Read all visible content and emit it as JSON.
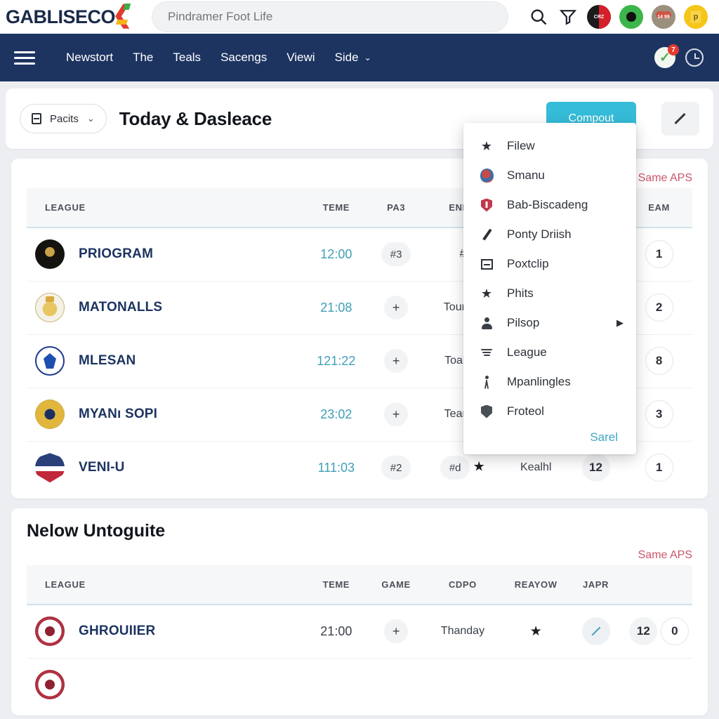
{
  "brand": {
    "name": "GABLISECO",
    "mark": "chevron-mark"
  },
  "search": {
    "placeholder": "Pindramer Foot Life",
    "value": ""
  },
  "top_icons": [
    {
      "name": "search-icon",
      "label": ""
    },
    {
      "name": "funnel-icon",
      "label": ""
    },
    {
      "name": "avatar-1",
      "label": "CRZ"
    },
    {
      "name": "avatar-2",
      "label": ""
    },
    {
      "name": "avatar-3",
      "label": "14 99"
    },
    {
      "name": "avatar-4",
      "label": "p"
    }
  ],
  "nav": {
    "menu_icon": "hamburger-icon",
    "items": [
      {
        "label": "Newstort",
        "caret": false
      },
      {
        "label": "The",
        "caret": false
      },
      {
        "label": "Teals",
        "caret": false
      },
      {
        "label": "Sacengs",
        "caret": false
      },
      {
        "label": "Viewi",
        "caret": false
      },
      {
        "label": "Side",
        "caret": true
      }
    ],
    "caret_glyph": "⌄",
    "notification_count": "7",
    "check_glyph": "✓"
  },
  "header": {
    "select_label": "Pacits",
    "select_caret": "⌄",
    "title": "Today & Dasleace",
    "primary_button": "Compout",
    "edit_button": "edit-pencil"
  },
  "menu": {
    "items": [
      {
        "label": "Filew",
        "icon": "star-icon",
        "glyph": "★",
        "submenu": false
      },
      {
        "label": "Smanu",
        "icon": "club-crest-icon",
        "glyph": "",
        "submenu": false
      },
      {
        "label": "Bab-Biscadeng",
        "icon": "shield-red-icon",
        "glyph": "",
        "submenu": false
      },
      {
        "label": "Ponty Driish",
        "icon": "pen-icon",
        "glyph": "",
        "submenu": false
      },
      {
        "label": "Poxtclip",
        "icon": "frame-icon",
        "glyph": "",
        "submenu": false
      },
      {
        "label": "Phits",
        "icon": "star-icon",
        "glyph": "★",
        "submenu": false
      },
      {
        "label": "Pilsop",
        "icon": "person-icon",
        "glyph": "",
        "submenu": true
      },
      {
        "label": "League",
        "icon": "lines-icon",
        "glyph": "",
        "submenu": false
      },
      {
        "label": "Mpanlingles",
        "icon": "figure-icon",
        "glyph": "",
        "submenu": false
      },
      {
        "label": "Froteol",
        "icon": "shield-gray-icon",
        "glyph": "",
        "submenu": false
      }
    ],
    "submenu_arrow": "▶",
    "footer_link": "Sarel"
  },
  "section1": {
    "link": "Same APS",
    "columns": [
      "LEAGUE",
      "TEME",
      "PA3",
      "ENEO",
      "",
      "",
      "EAM"
    ],
    "rows": [
      {
        "crest": "c-eagle",
        "team": "PRIOGRAM",
        "time": "12:00",
        "chip1": "#3",
        "chip2": "#",
        "text": "",
        "star": false,
        "num": "",
        "rank": "1"
      },
      {
        "crest": "c-madrid",
        "team": "MATONALLS",
        "time": "21:08",
        "chip1": "+",
        "chip2": "",
        "text": "TounaB",
        "star": false,
        "num": "",
        "rank": "2"
      },
      {
        "crest": "c-chelsea",
        "team": "MLESAN",
        "time": "121:22",
        "chip1": "+",
        "chip2": "",
        "text": "Toabka",
        "star": false,
        "num": "",
        "rank": "8"
      },
      {
        "crest": "c-gold",
        "team": "MYANı SOPI",
        "time": "23:02",
        "chip1": "+",
        "chip2": "",
        "text": "Tean4a",
        "star": false,
        "num": "",
        "rank": "3"
      },
      {
        "crest": "c-usa",
        "team": "VENI-U",
        "time": "111:03",
        "chip1": "#2",
        "chip2": "#d",
        "text": "Kealhl",
        "star": true,
        "num": "12",
        "rank": "1"
      }
    ]
  },
  "section2": {
    "title": "Nelow Untoguite",
    "link": "Same APS",
    "columns": [
      "LEAGUE",
      "TEME",
      "GAME",
      "CDPO",
      "REAYOW",
      "JAPR",
      ""
    ],
    "rows": [
      {
        "crest": "c-rangers",
        "team": "GHROUIӀER",
        "time": "21:00",
        "chip1": "+",
        "text": "Thanday",
        "star": true,
        "edit": true,
        "num": "12",
        "rank": "0"
      },
      {
        "crest": "c-rangers",
        "team": "",
        "time": "",
        "chip1": "",
        "text": "",
        "star": false,
        "edit": false,
        "num": "",
        "rank": ""
      }
    ]
  }
}
